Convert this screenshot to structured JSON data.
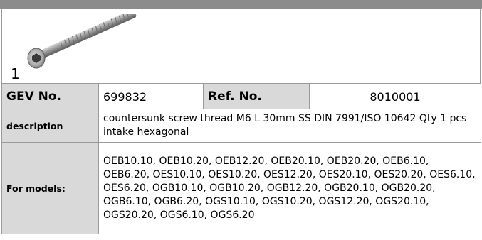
{
  "item": {
    "number": "1",
    "image": "countersunk-screw-image"
  },
  "header_row": {
    "gev_label": "GEV No.",
    "gev_value": "699832",
    "ref_label": "Ref. No.",
    "ref_value": "8010001"
  },
  "description": {
    "label": "description",
    "text": "countersunk screw  thread M6 L 30mm SS DIN 7991/ISO 10642 Qty 1 pcs intake hexagonal"
  },
  "models": {
    "label": "For models:",
    "text": "OEB10.10, OEB10.20, OEB12.20, OEB20.10, OEB20.20, OEB6.10, OEB6.20, OES10.10, OES10.20, OES12.20, OES20.10, OES20.20, OES6.10, OES6.20, OGB10.10, OGB10.20, OGB12.20, OGB20.10, OGB20.20, OGB6.10, OGB6.20, OGS10.10, OGS10.20, OGS12.20, OGS20.10, OGS20.20, OGS6.10, OGS6.20"
  },
  "colors": {
    "top_bar": "#8c8c8c",
    "header_bg": "#d9d9d9",
    "border": "#9a9a9a"
  }
}
